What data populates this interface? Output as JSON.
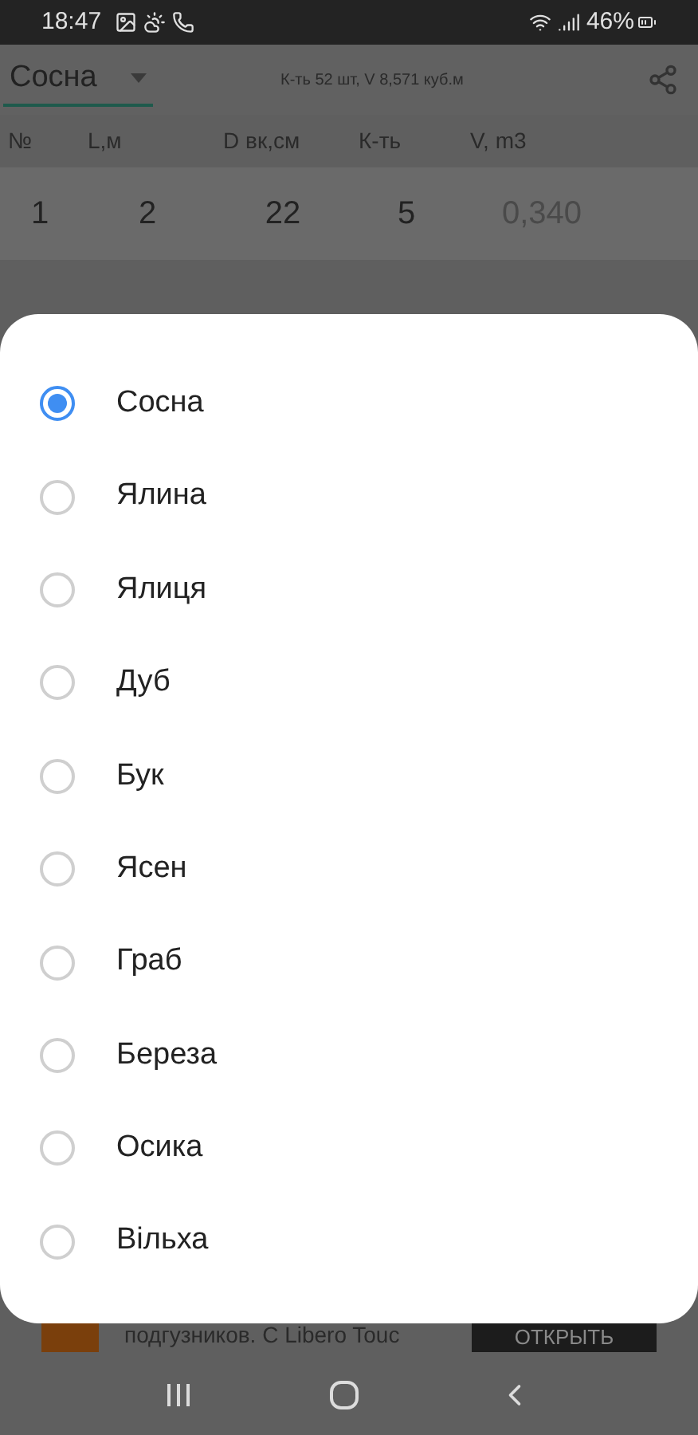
{
  "status_bar": {
    "time": "18:47",
    "battery": "46%"
  },
  "header": {
    "species": "Сосна",
    "summary": "К-ть 52 шт, V 8,571 куб.м"
  },
  "table": {
    "columns": [
      "№",
      "L,м",
      "D вк,см",
      "К-ть",
      "V, m3"
    ],
    "rows": [
      [
        "1",
        "2",
        "22",
        "5",
        "0,340"
      ]
    ]
  },
  "dialog": {
    "options": [
      {
        "label": "Сосна",
        "selected": true
      },
      {
        "label": "Ялина",
        "selected": false
      },
      {
        "label": "Ялиця",
        "selected": false
      },
      {
        "label": "Дуб",
        "selected": false
      },
      {
        "label": "Бук",
        "selected": false
      },
      {
        "label": "Ясен",
        "selected": false
      },
      {
        "label": "Граб",
        "selected": false
      },
      {
        "label": "Береза",
        "selected": false
      },
      {
        "label": "Осика",
        "selected": false
      },
      {
        "label": "Вільха",
        "selected": false
      }
    ]
  },
  "ad": {
    "text": "подгузников. С Libero Touc",
    "button": "ОТКРЫТЬ"
  }
}
